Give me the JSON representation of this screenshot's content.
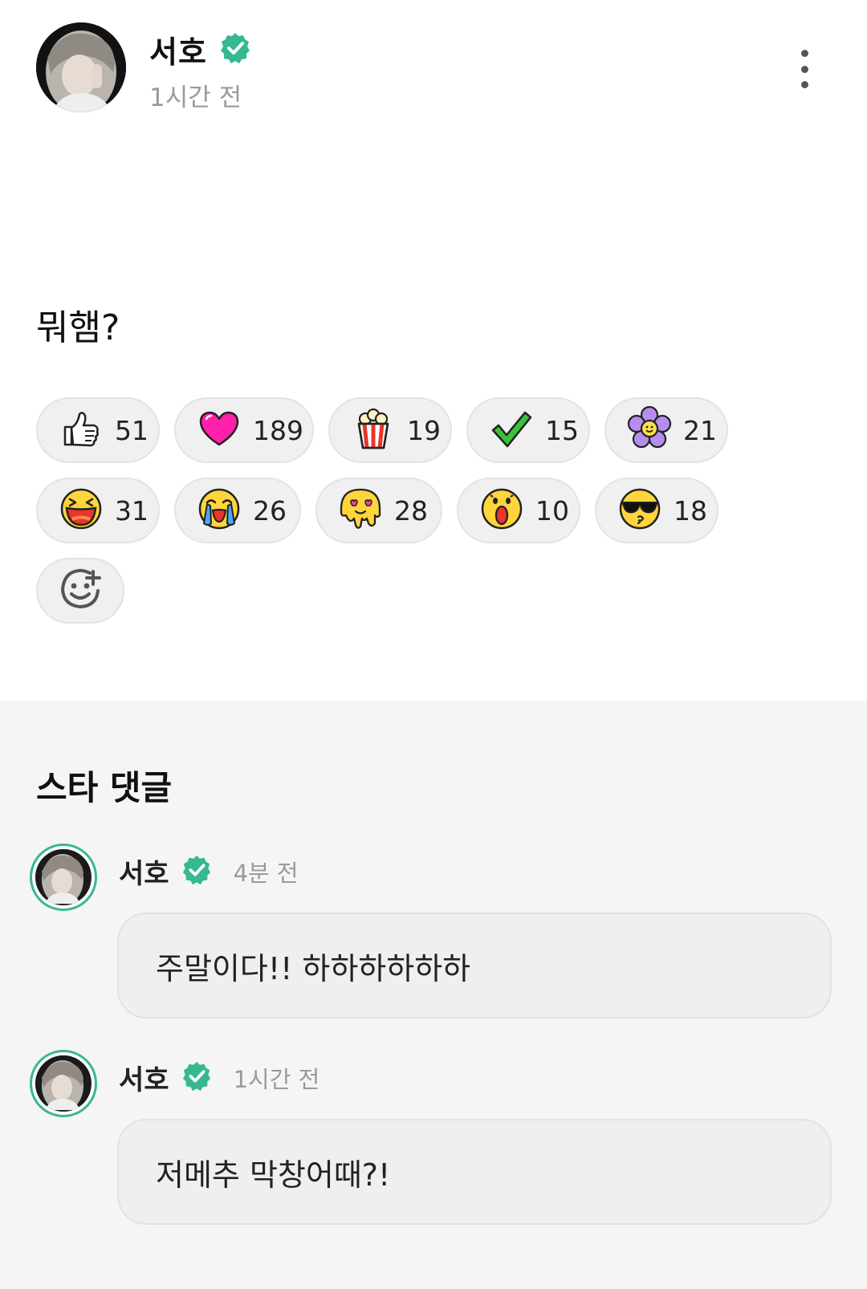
{
  "post": {
    "author": "서호",
    "time": "1시간 전",
    "body": "뭐햄?",
    "accent_color": "#36b891"
  },
  "reactions": [
    {
      "icon": "thumbs-up-icon",
      "count": "51"
    },
    {
      "icon": "heart-icon",
      "count": "189"
    },
    {
      "icon": "popcorn-icon",
      "count": "19"
    },
    {
      "icon": "checkmark-icon",
      "count": "15"
    },
    {
      "icon": "flower-icon",
      "count": "21"
    },
    {
      "icon": "laughing-face-icon",
      "count": "31"
    },
    {
      "icon": "crying-face-icon",
      "count": "26"
    },
    {
      "icon": "heart-eyes-melting-face-icon",
      "count": "28"
    },
    {
      "icon": "surprised-face-icon",
      "count": "10"
    },
    {
      "icon": "sunglasses-kiss-face-icon",
      "count": "18"
    }
  ],
  "add_reaction_icon": "add-emoji-icon",
  "comments_section": {
    "title": "스타 댓글",
    "comments": [
      {
        "author": "서호",
        "time": "4분 전",
        "text": "주말이다!! 하하하하하하"
      },
      {
        "author": "서호",
        "time": "1시간 전",
        "text": "저메추 막창어때?!"
      }
    ]
  }
}
